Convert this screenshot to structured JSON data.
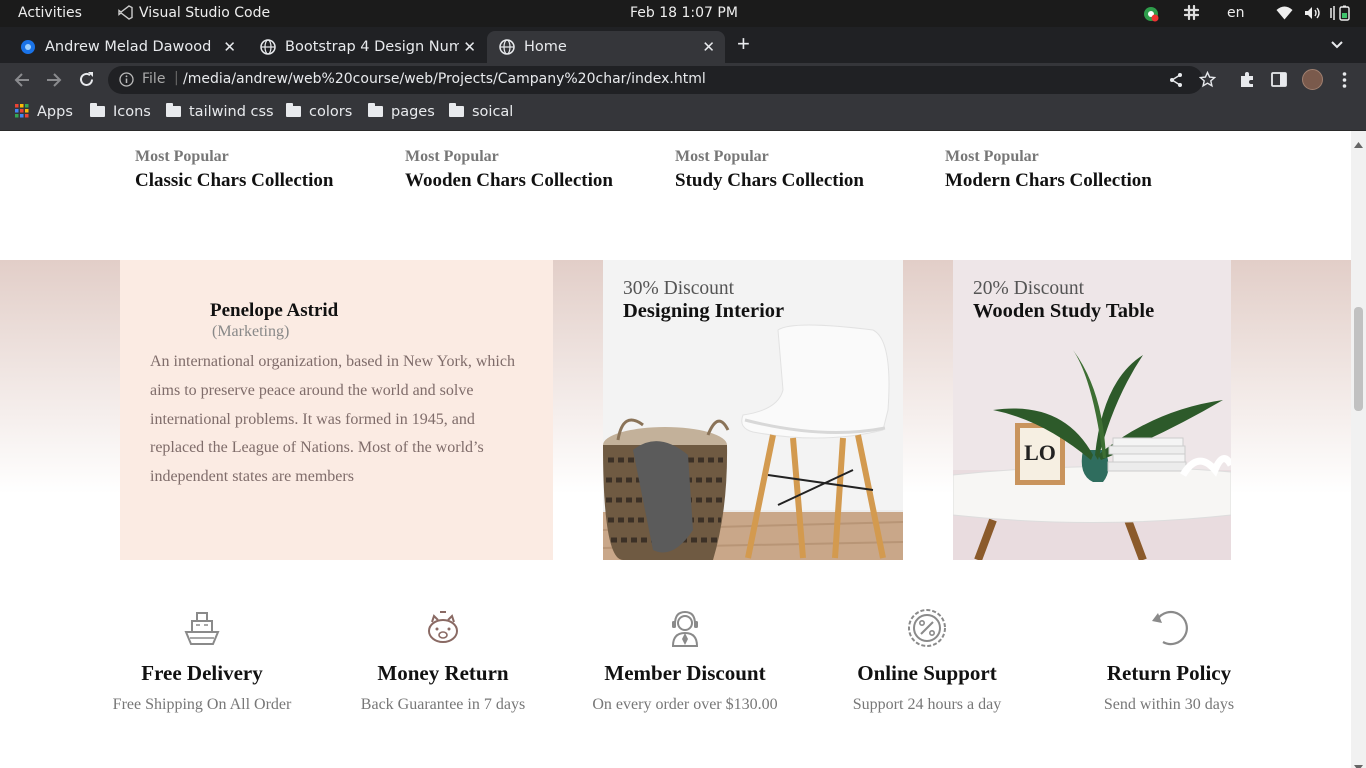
{
  "topbar": {
    "activities": "Activities",
    "app_name": "Visual Studio Code",
    "datetime": "Feb 18  1:07 PM",
    "language": "en"
  },
  "tabs": [
    {
      "title": "Andrew Melad Dawood"
    },
    {
      "title": "Bootstrap 4 Design Numb"
    },
    {
      "title": "Home"
    }
  ],
  "browser": {
    "scheme_label": "File",
    "url": "/media/andrew/web%20course/web/Projects/Campany%20char/index.html"
  },
  "bookmarks": [
    "Apps",
    "Icons",
    "tailwind css",
    "colors",
    "pages",
    "soical"
  ],
  "collections": [
    {
      "label": "Most Popular",
      "title": "Classic Chars Collection"
    },
    {
      "label": "Most Popular",
      "title": "Wooden Chars Collection"
    },
    {
      "label": "Most Popular",
      "title": "Study Chars Collection"
    },
    {
      "label": "Most Popular",
      "title": "Modern Chars Collection"
    }
  ],
  "testimonial": {
    "name": "Penelope Astrid",
    "role": "(Marketing)",
    "text": "An international organization, based in New York, which aims to preserve peace around the world and solve international problems. It was formed in 1945, and replaced the League of Nations. Most of the world’s independent states are members"
  },
  "promos": [
    {
      "discount": "30% Discount",
      "name": "Designing Interior"
    },
    {
      "discount": "20% Discount",
      "name": "Wooden Study Table"
    }
  ],
  "features": [
    {
      "icon": "ship-icon",
      "title": "Free Delivery",
      "subtitle": "Free Shipping On All Order"
    },
    {
      "icon": "piggy-bank-icon",
      "title": "Money Return",
      "subtitle": "Back Guarantee in 7 days"
    },
    {
      "icon": "support-agent-icon",
      "title": "Member Discount",
      "subtitle": "On every order over $130.00"
    },
    {
      "icon": "percent-badge-icon",
      "title": "Online Support",
      "subtitle": "Support 24 hours a day"
    },
    {
      "icon": "return-arrow-icon",
      "title": "Return Policy",
      "subtitle": "Send within 30 days"
    }
  ],
  "colors": {
    "accent_pink": "#fbebe3",
    "band_top": "#e2cec8",
    "icon_color": "#8a6a64"
  }
}
